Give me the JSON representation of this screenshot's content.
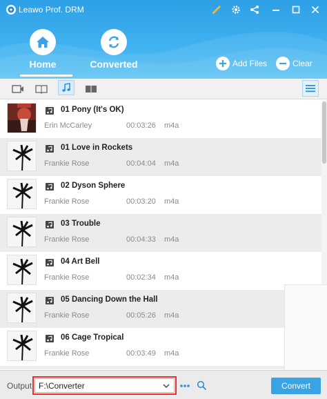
{
  "app": {
    "title": "Leawo Prof. DRM"
  },
  "window_icons": [
    "brush-icon",
    "gear-icon",
    "share-icon",
    "minimize-icon",
    "maximize-icon",
    "close-icon"
  ],
  "nav": {
    "home_label": "Home",
    "converted_label": "Converted",
    "active": "Home"
  },
  "actions": {
    "add_files_label": "Add Files",
    "clear_label": "Clear"
  },
  "toolbar": {
    "categories": [
      "video-icon",
      "ebook-icon",
      "music-icon",
      "audiobook-icon"
    ],
    "active": "music-icon"
  },
  "songs": [
    {
      "title": "01 Pony (It's OK)",
      "artist": "Erin McCarley",
      "duration": "00:03:26",
      "format": "m4a"
    },
    {
      "title": "01 Love in Rockets",
      "artist": "Frankie Rose",
      "duration": "00:04:04",
      "format": "m4a"
    },
    {
      "title": "02 Dyson Sphere",
      "artist": "Frankie Rose",
      "duration": "00:03:20",
      "format": "m4a"
    },
    {
      "title": "03 Trouble",
      "artist": "Frankie Rose",
      "duration": "00:04:33",
      "format": "m4a"
    },
    {
      "title": "04 Art Bell",
      "artist": "Frankie Rose",
      "duration": "00:02:34",
      "format": "m4a"
    },
    {
      "title": "05 Dancing Down the Hall",
      "artist": "Frankie Rose",
      "duration": "00:05:26",
      "format": "m4a"
    },
    {
      "title": "06 Cage Tropical",
      "artist": "Frankie Rose",
      "duration": "00:03:49",
      "format": "m4a"
    }
  ],
  "bottom": {
    "output_label": "Output",
    "output_value": "F:\\Converter",
    "convert_label": "Convert"
  },
  "colors": {
    "header": "#3fb1ef",
    "accent": "#3aa3e4",
    "highlight_border": "#e63030"
  }
}
